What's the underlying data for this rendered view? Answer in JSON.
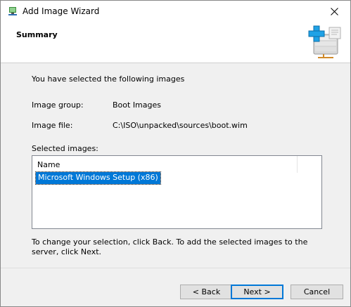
{
  "window": {
    "title": "Add Image Wizard"
  },
  "header": {
    "title": "Summary"
  },
  "content": {
    "intro": "You have selected the following images",
    "image_group_label": "Image group:",
    "image_group_value": "Boot Images",
    "image_file_label": "Image file:",
    "image_file_value": "C:\\ISO\\unpacked\\sources\\boot.wim",
    "selected_images_label": "Selected images:",
    "list_column_header": "Name",
    "list_rows": [
      "Microsoft Windows Setup (x86)"
    ],
    "instructions": "To change your selection, click Back. To add the selected images to the server, click Next."
  },
  "buttons": {
    "back": "< Back",
    "next": "Next >",
    "cancel": "Cancel"
  },
  "colors": {
    "selection": "#0078d7",
    "accent_icon": "#1fa2e6"
  }
}
